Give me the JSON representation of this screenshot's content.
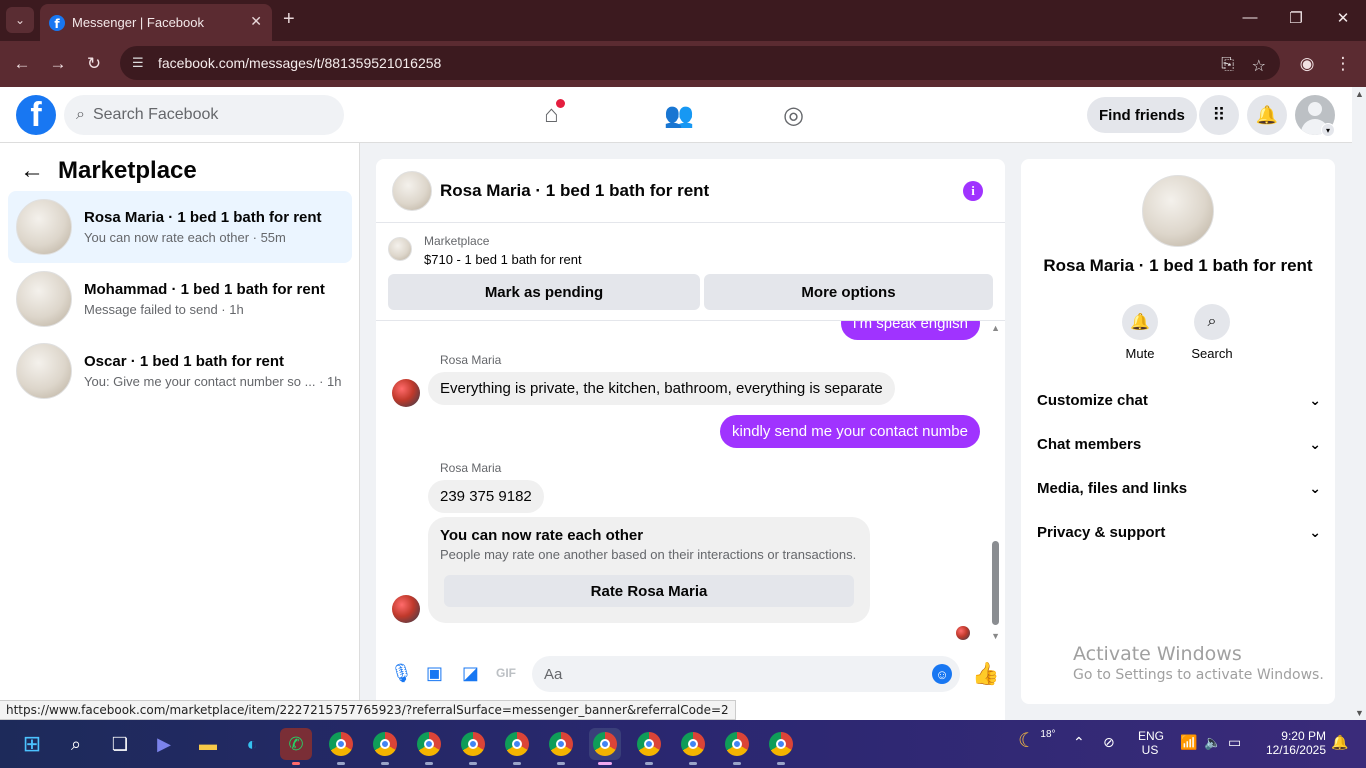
{
  "browser": {
    "tab_title": "Messenger | Facebook",
    "url": "facebook.com/messages/t/881359521016258",
    "status_url": "https://www.facebook.com/marketplace/item/2227215757765923/?referralSurface=messenger_banner&referralCode=2"
  },
  "fb_header": {
    "logo": "f",
    "search_placeholder": "Search Facebook",
    "find_friends_label": "Find friends"
  },
  "sidebar": {
    "title": "Marketplace",
    "conversations": [
      {
        "title": "Rosa Maria · 1 bed 1 bath for rent",
        "preview": "You can now rate each other · 55m",
        "active": true
      },
      {
        "title": "Mohammad · 1 bed 1 bath for rent",
        "preview": "Message failed to send · 1h",
        "active": false
      },
      {
        "title": "Oscar · 1 bed 1 bath for rent",
        "preview": "You: Give me your contact number so ... · 1h",
        "active": false
      }
    ]
  },
  "chat": {
    "title": "Rosa Maria · 1 bed 1 bath for rent",
    "banner": {
      "source": "Marketplace",
      "item": "$710 - 1 bed 1 bath for rent",
      "pending_label": "Mark as pending",
      "more_label": "More options"
    },
    "messages": [
      {
        "from": "me",
        "text": "I'm speak english"
      },
      {
        "from": "Rosa Maria",
        "text": "Everything is private, the kitchen, bathroom, everything is separate"
      },
      {
        "from": "me",
        "text": "kindly send me your contact numbe"
      },
      {
        "from": "Rosa Maria",
        "text": "239 375 9182"
      }
    ],
    "rate_card": {
      "title": "You can now rate each other",
      "description": "People may rate one another based on their interactions or transactions.",
      "button": "Rate Rosa Maria"
    },
    "composer_placeholder": "Aa"
  },
  "right_panel": {
    "title": "Rosa Maria · 1 bed 1 bath for rent",
    "mute_label": "Mute",
    "search_label": "Search",
    "sections": [
      "Customize chat",
      "Chat members",
      "Media, files and links",
      "Privacy & support"
    ]
  },
  "watermark": {
    "line1": "Activate Windows",
    "line2": "Go to Settings to activate Windows."
  },
  "taskbar": {
    "temperature": "18°",
    "lang1": "ENG",
    "lang2": "US",
    "time": "9:20 PM",
    "date": "12/16/2025"
  },
  "colors": {
    "fb_blue": "#1877f2",
    "message_purple": "#a033ff",
    "browser_chrome": "#5b2b31"
  }
}
